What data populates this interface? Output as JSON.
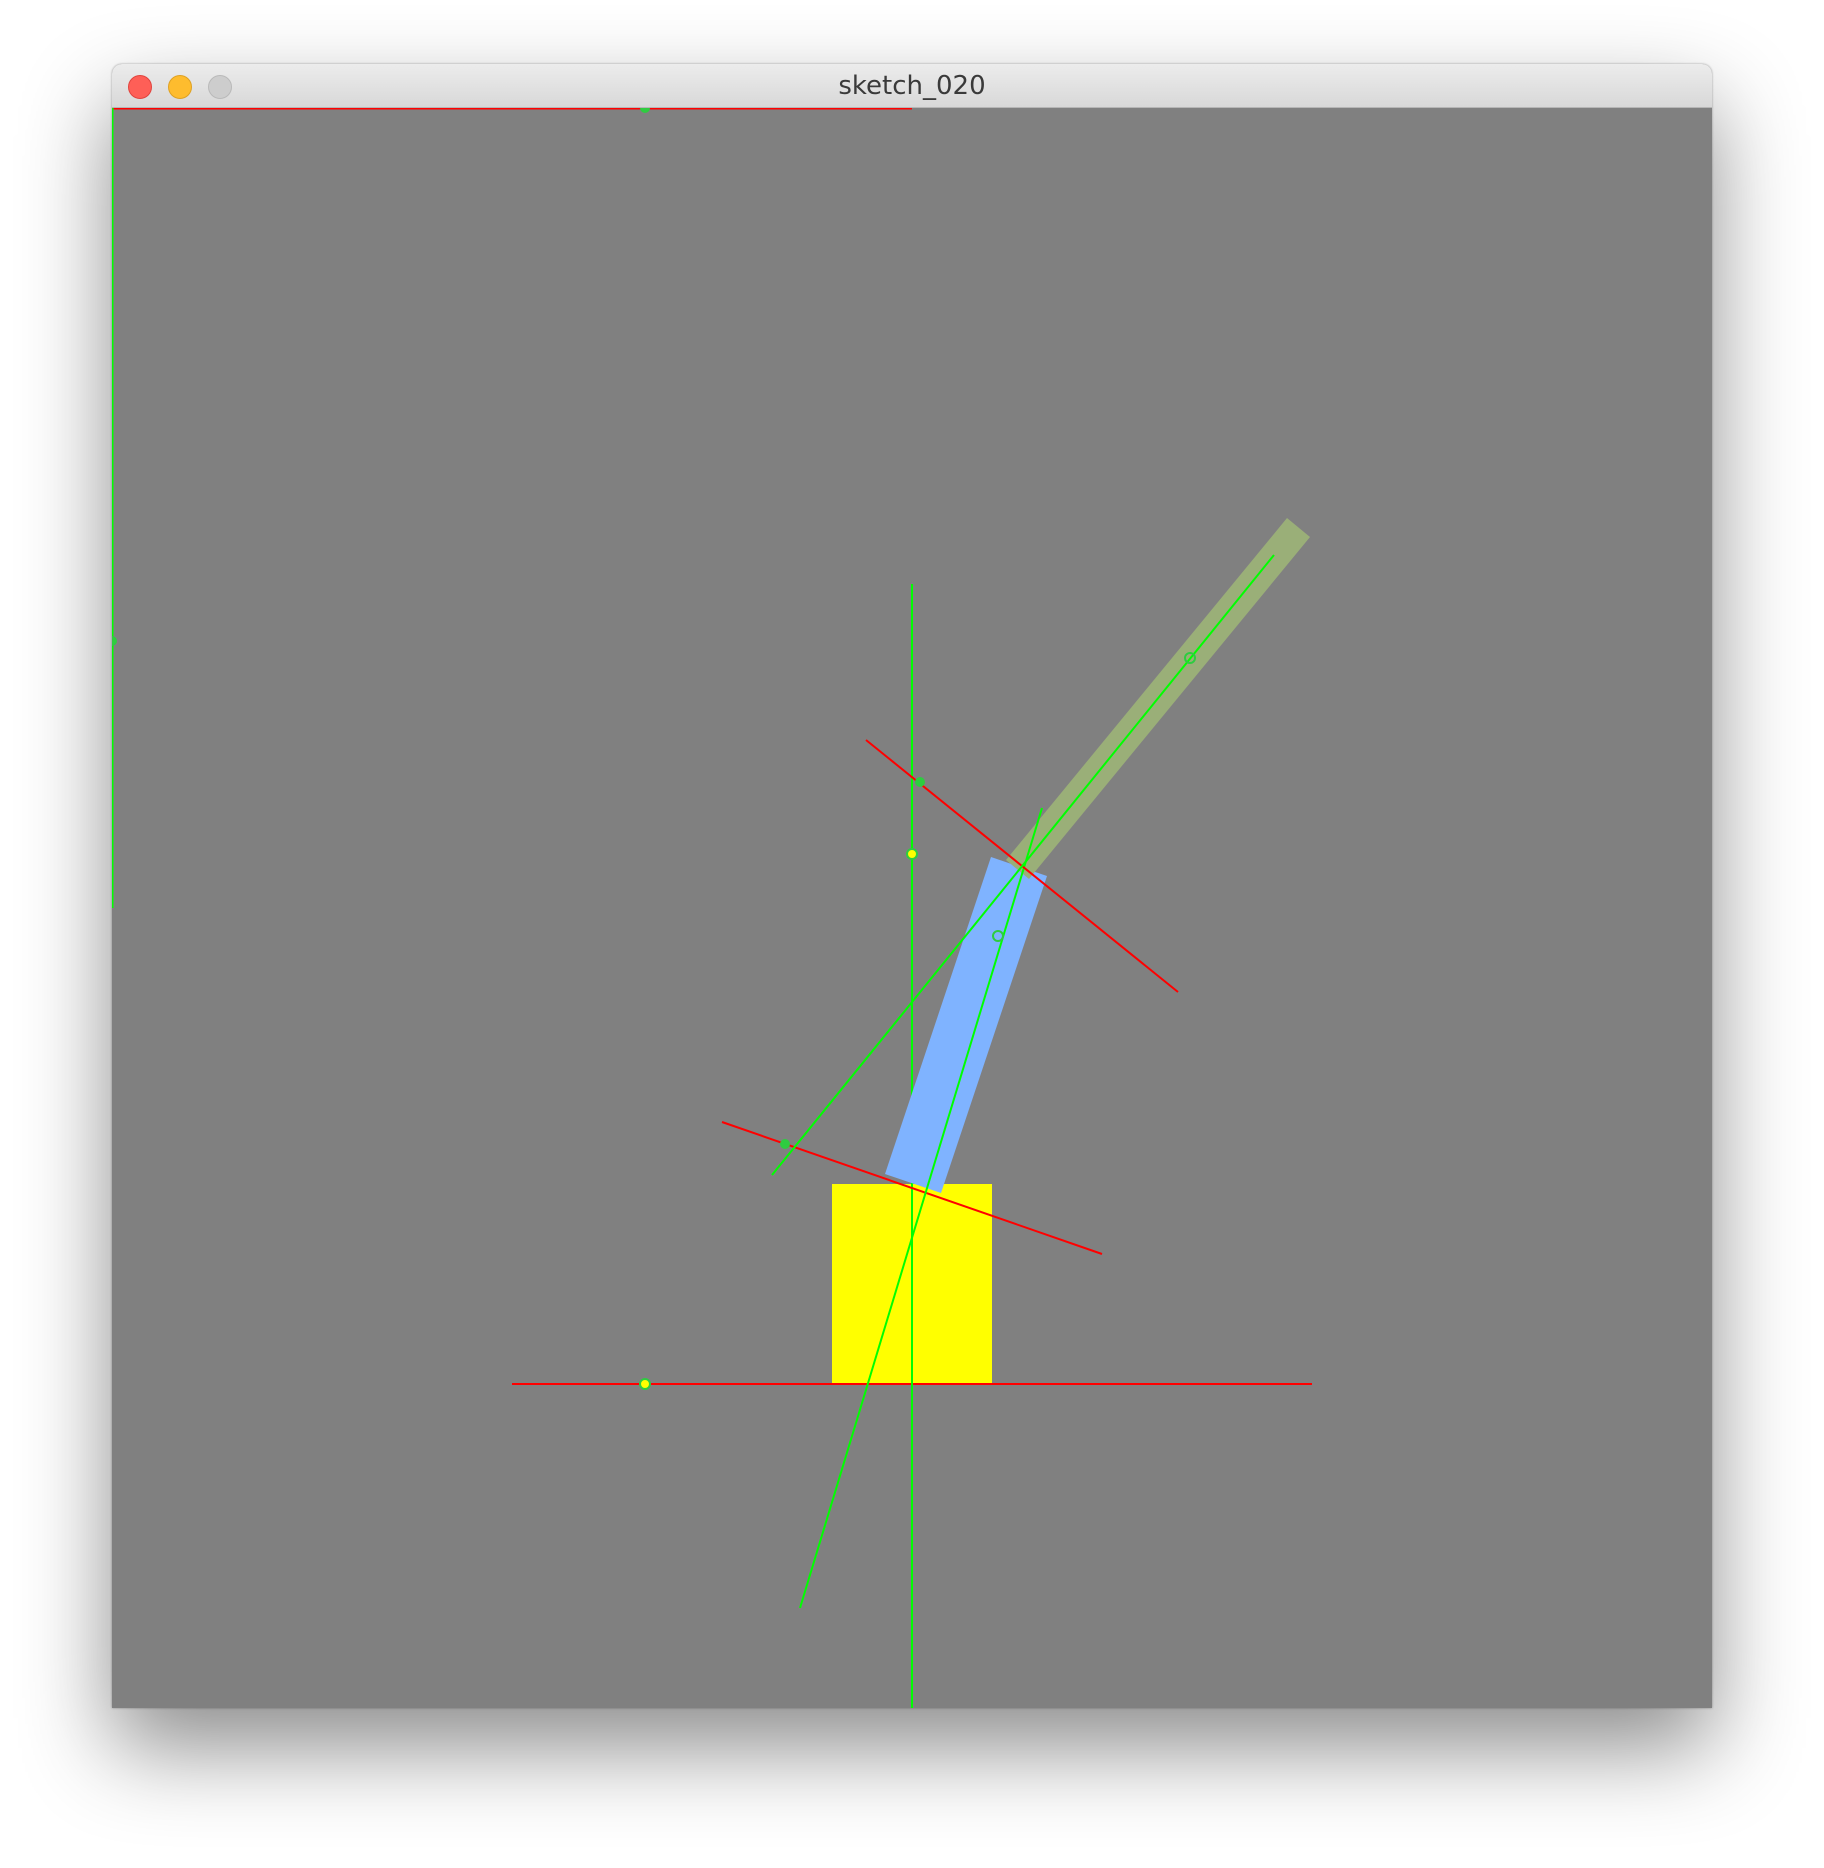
{
  "window": {
    "title": "sketch_020"
  },
  "colors": {
    "background": "#808080",
    "base": "#ffff00",
    "lower_arm": "#7fb3ff",
    "upper_arm": "#9aaf78",
    "axis_red": "#ff0000",
    "axis_green": "#00ff00"
  },
  "icons": {
    "close": "close-window-icon",
    "minimize": "minimize-window-icon",
    "zoom": "zoom-window-icon"
  }
}
